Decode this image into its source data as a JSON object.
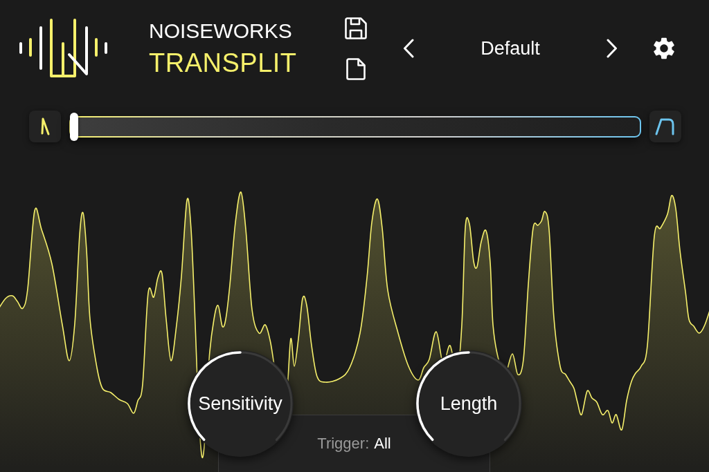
{
  "brand": {
    "company": "NOISEWORKS",
    "product": "TRANSPLIT"
  },
  "preset": {
    "name": "Default"
  },
  "filter_slider": {
    "level": 0
  },
  "knobs": [
    {
      "label": "Sensitivity",
      "level": 0.5
    },
    {
      "label": "Length",
      "level": 0.5
    }
  ],
  "trigger": {
    "label": "Trigger:",
    "value": "All"
  }
}
